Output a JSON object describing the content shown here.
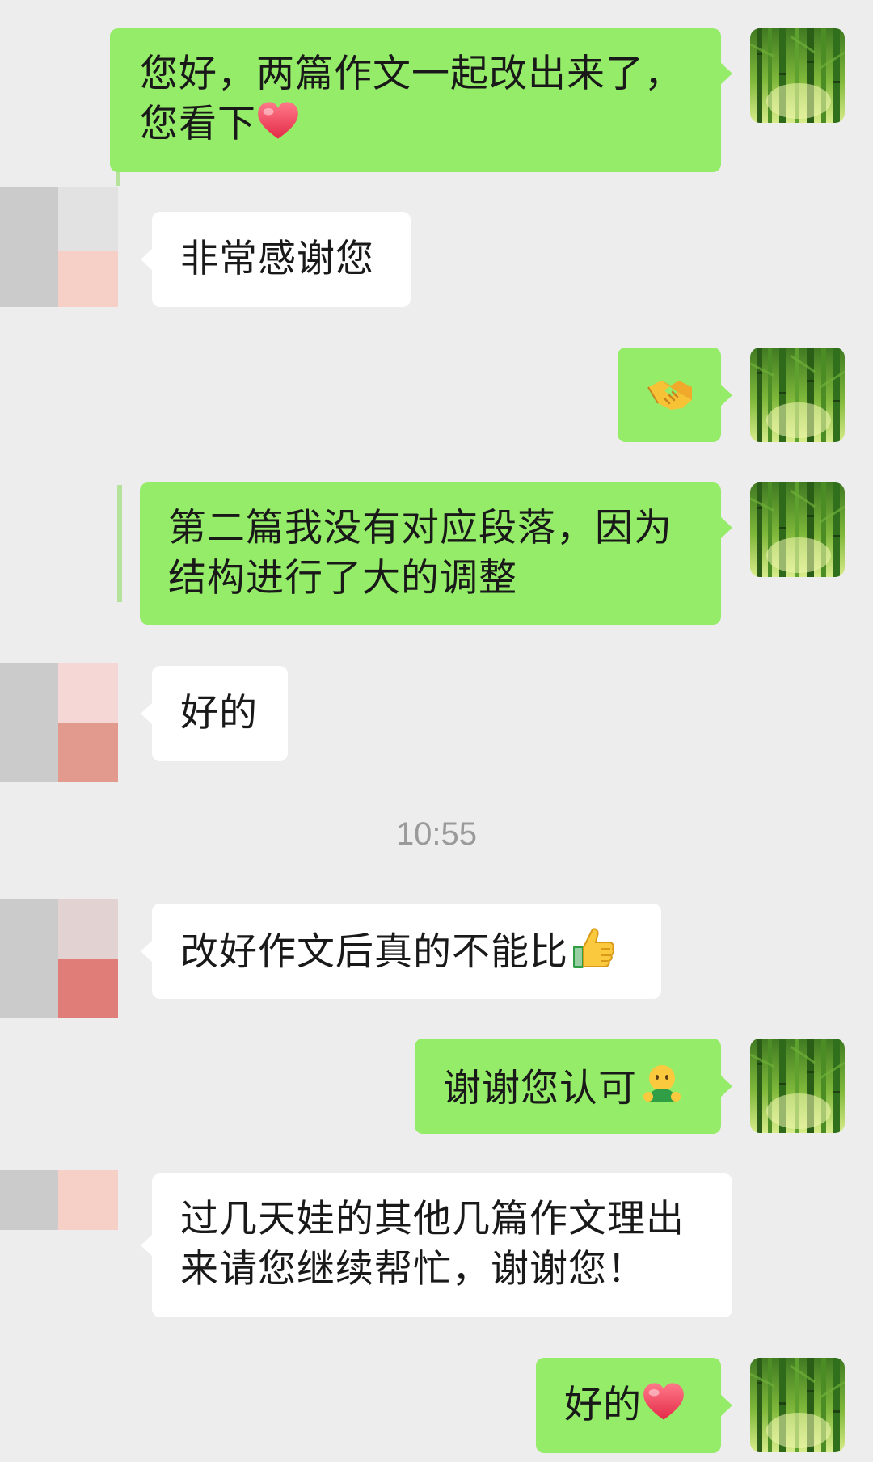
{
  "messages": [
    {
      "side": "me",
      "text": "您好，两篇作文一起改出来了，您看下",
      "trailing_icon": "heart-icon"
    },
    {
      "side": "them",
      "text": "非常感谢您"
    },
    {
      "side": "me",
      "text": "",
      "trailing_icon": "handshake-icon"
    },
    {
      "side": "me",
      "text": "第二篇我没有对应段落，因为结构进行了大的调整"
    },
    {
      "side": "them",
      "text": "好的"
    },
    {
      "side": "them",
      "text": "改好作文后真的不能比",
      "trailing_icon": "thumbs-up-icon"
    },
    {
      "side": "me",
      "text": "谢谢您认可",
      "trailing_icon": "hugging-person-icon"
    },
    {
      "side": "them",
      "text": "过几天娃的其他几篇作文理出来请您继续帮忙，谢谢您！"
    },
    {
      "side": "me",
      "text": "好的",
      "trailing_icon": "heart-icon"
    }
  ],
  "msg1": {
    "line1": "您好，两篇作文一起改出来了，",
    "line2": "您看下"
  },
  "msg2": {
    "text": "非常感谢您"
  },
  "msg4": {
    "line1": "第二篇我没有对应段落，因为",
    "line2": "结构进行了大的调整"
  },
  "msg5": {
    "text": "好的"
  },
  "timestamp": "10:55",
  "msg6": {
    "text": "改好作文后真的不能比"
  },
  "msg7": {
    "text": "谢谢您认可"
  },
  "msg8": {
    "line1": "过几天娃的其他几篇作文理出",
    "line2": "来请您继续帮忙，谢谢您！"
  },
  "msg9": {
    "text": "好的"
  },
  "colors": {
    "background": "#ededed",
    "outgoing_bubble": "#95ec69",
    "incoming_bubble": "#ffffff",
    "timestamp_text": "#9a9a9a",
    "heart": "#f0405a"
  },
  "icons": {
    "my_avatar": "bamboo-avatar",
    "their_avatar": "pixelated-avatar"
  }
}
